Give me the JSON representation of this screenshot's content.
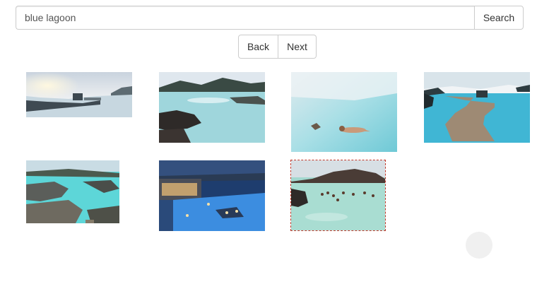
{
  "search": {
    "query": "blue lagoon",
    "button_label": "Search"
  },
  "pager": {
    "back_label": "Back",
    "next_label": "Next"
  },
  "results": {
    "images": [
      {
        "name": "blue-lagoon-foggy-sunset"
      },
      {
        "name": "blue-lagoon-lava-rocks"
      },
      {
        "name": "blue-lagoon-woman-floating"
      },
      {
        "name": "blue-lagoon-wooden-boardwalk"
      },
      {
        "name": "blue-lagoon-aerial-view"
      },
      {
        "name": "blue-lagoon-night-lights"
      },
      {
        "name": "blue-lagoon-bathers-mountain"
      }
    ],
    "selected_index": 6
  },
  "colors": {
    "lagoon": "#8fd4dc",
    "selection_border": "#c0392b"
  }
}
